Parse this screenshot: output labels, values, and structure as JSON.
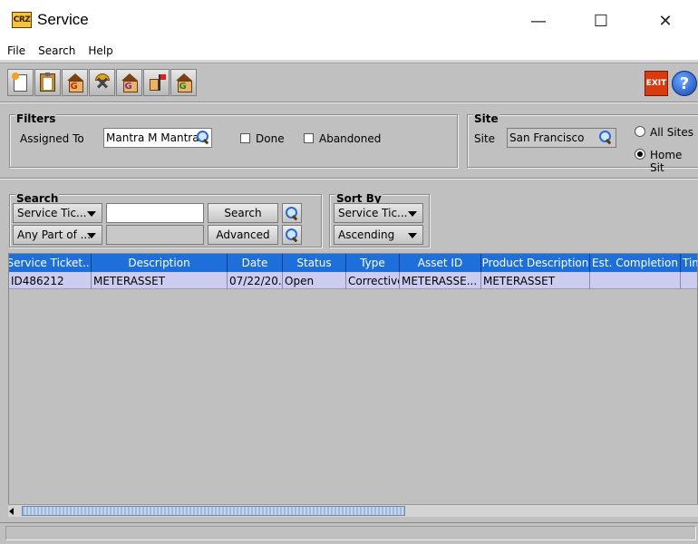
{
  "window": {
    "title": "Service",
    "app_icon_text": "CRZ",
    "minimize": "—",
    "maximize": "☐",
    "close": "✕"
  },
  "menu": [
    "File",
    "Search",
    "Help"
  ],
  "toolbar": {
    "buttons": [
      "new-document-icon",
      "clipboard-icon",
      "house-g-icon",
      "tools-icon",
      "house-g-purple-icon",
      "flag-icon",
      "house-refresh-icon"
    ],
    "house_letter": "G",
    "exit_label": "EXIT",
    "help_label": "?"
  },
  "filters": {
    "title": "Filters",
    "assigned_to_label": "Assigned To",
    "assigned_to_value": "Mantra M Mantra",
    "done_label": "Done",
    "done_checked": false,
    "abandoned_label": "Abandoned",
    "abandoned_checked": false
  },
  "site": {
    "title": "Site",
    "site_label": "Site",
    "site_value": "San Francisco",
    "all_sites_label": "All Sites",
    "home_site_label": "Home Sit",
    "selected": "home_site"
  },
  "search": {
    "title": "Search",
    "field_combo": "Service Tic...",
    "match_combo": "Any Part of ...",
    "query_value": "",
    "search_button": "Search",
    "advanced_button": "Advanced"
  },
  "sort": {
    "title": "Sort By",
    "field_combo": "Service Tic...",
    "order_combo": "Ascending"
  },
  "table": {
    "columns": [
      "Service Ticket...",
      "Description",
      "Date",
      "Status",
      "Type",
      "Asset ID",
      "Product Description",
      "Est. Completion",
      "Tim"
    ],
    "rows": [
      [
        "ID486212",
        "METERASSET",
        "07/22/20...",
        "Open",
        "Corrective",
        "METERASSE...",
        "METERASSET",
        "",
        ""
      ]
    ],
    "header_color": "#1f6fdb",
    "selected_row_color": "#ccccf0"
  }
}
